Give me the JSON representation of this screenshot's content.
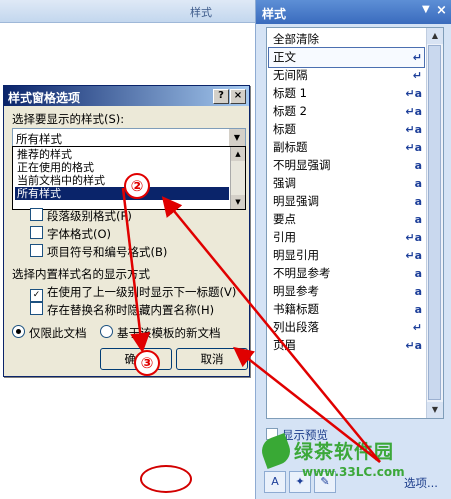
{
  "background": {
    "ribbon_labels": [
      "样式",
      "样式"
    ]
  },
  "pane": {
    "title": "样式",
    "menu_glyph": "▼",
    "close_glyph": "×",
    "styles": [
      {
        "label": "全部清除",
        "icon": ""
      },
      {
        "label": "正文",
        "icon": "↵"
      },
      {
        "label": "无间隔",
        "icon": "↵"
      },
      {
        "label": "标题 1",
        "icon": "↵a"
      },
      {
        "label": "标题 2",
        "icon": "↵a"
      },
      {
        "label": "标题",
        "icon": "↵a"
      },
      {
        "label": "副标题",
        "icon": "↵a"
      },
      {
        "label": "不明显强调",
        "icon": "a"
      },
      {
        "label": "强调",
        "icon": "a"
      },
      {
        "label": "明显强调",
        "icon": "a"
      },
      {
        "label": "要点",
        "icon": "a"
      },
      {
        "label": "引用",
        "icon": "↵a"
      },
      {
        "label": "明显引用",
        "icon": "↵a"
      },
      {
        "label": "不明显参考",
        "icon": "a"
      },
      {
        "label": "明显参考",
        "icon": "a"
      },
      {
        "label": "书籍标题",
        "icon": "a"
      },
      {
        "label": "列出段落",
        "icon": "↵"
      },
      {
        "label": "页眉",
        "icon": "↵a"
      }
    ],
    "selected_style": "正文",
    "show_preview_label": "显示预览",
    "options_label": "选项...",
    "footer_icons": [
      "new-style-icon",
      "style-inspector-icon",
      "manage-styles-icon"
    ]
  },
  "dialog": {
    "title": "样式窗格选项",
    "help_glyph": "?",
    "close_glyph": "×",
    "select_label": "选择要显示的样式(S):",
    "select_value": "所有样式",
    "dropdown_options": [
      "推荐的样式",
      "正在使用的格式",
      "当前文档中的样式",
      "所有样式"
    ],
    "dropdown_selected": "所有样式",
    "format_options": [
      {
        "label": "段落级别格式(P)",
        "checked": false
      },
      {
        "label": "字体格式(O)",
        "checked": false
      },
      {
        "label": "项目符号和编号格式(B)",
        "checked": false
      }
    ],
    "builtin_label": "选择内置样式名的显示方式",
    "builtin_options": [
      {
        "label": "在使用了上一级别时显示下一标题(V)",
        "checked": true
      },
      {
        "label": "存在替换名称时隐藏内置名称(H)",
        "checked": false
      }
    ],
    "scope_options": [
      {
        "label": "仅限此文档",
        "checked": true
      },
      {
        "label": "基于该模板的新文档",
        "checked": false
      }
    ],
    "ok_label": "确定",
    "cancel_label": "取消"
  },
  "annotations": {
    "markers": [
      "②",
      "③"
    ],
    "color": "#e00000"
  },
  "watermark": {
    "name": "绿茶软件园",
    "url": "www.33LC.com"
  }
}
